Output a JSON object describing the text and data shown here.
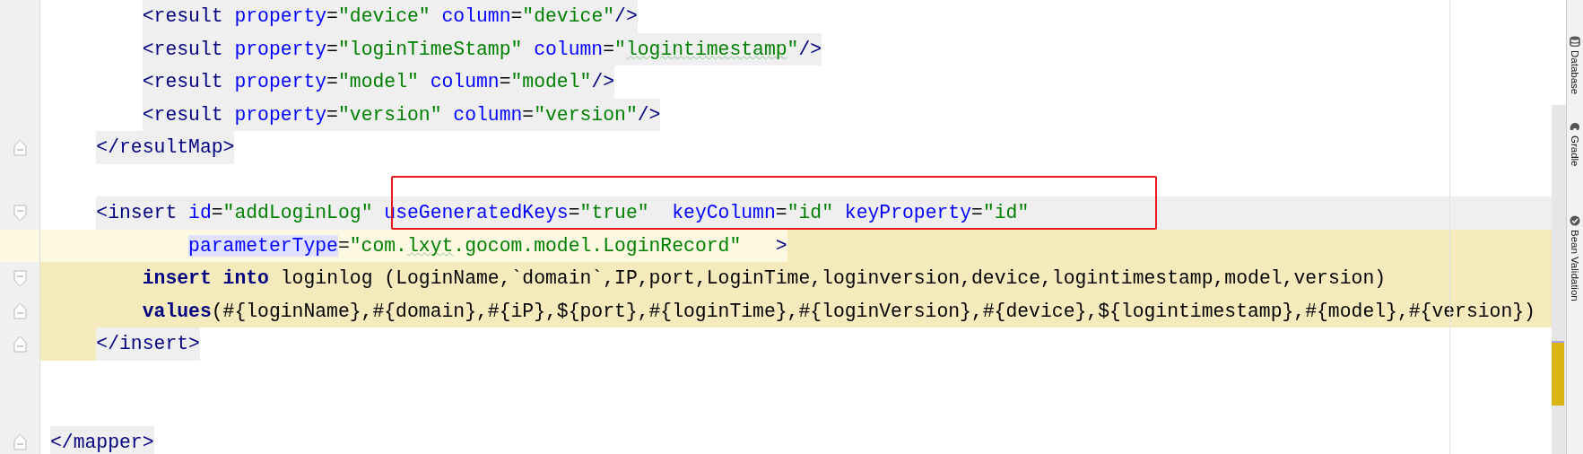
{
  "editor": {
    "lines": [
      {
        "kind": "tag",
        "tokens": [
          {
            "kind": "tag",
            "text": "        <result "
          },
          {
            "kind": "attr",
            "text": "property"
          },
          {
            "kind": "text",
            "text": "="
          },
          {
            "kind": "value",
            "text": "\"device\""
          },
          {
            "kind": "attr",
            "text": " column"
          },
          {
            "kind": "text",
            "text": "="
          },
          {
            "kind": "value",
            "text": "\"device\""
          },
          {
            "kind": "tag",
            "text": "/>"
          }
        ]
      },
      {
        "kind": "tag",
        "tokens": [
          {
            "kind": "tag",
            "text": "        <result "
          },
          {
            "kind": "attr",
            "text": "property"
          },
          {
            "kind": "text",
            "text": "="
          },
          {
            "kind": "value",
            "text": "\"loginTimeStamp\""
          },
          {
            "kind": "attr",
            "text": " column"
          },
          {
            "kind": "text",
            "text": "="
          },
          {
            "kind": "value",
            "text": "\""
          },
          {
            "kind": "value",
            "text": "logintimestamp",
            "typo": true
          },
          {
            "kind": "value",
            "text": "\""
          },
          {
            "kind": "tag",
            "text": "/>"
          }
        ]
      },
      {
        "kind": "tag",
        "tokens": [
          {
            "kind": "tag",
            "text": "        <result "
          },
          {
            "kind": "attr",
            "text": "property"
          },
          {
            "kind": "text",
            "text": "="
          },
          {
            "kind": "value",
            "text": "\"model\""
          },
          {
            "kind": "attr",
            "text": " column"
          },
          {
            "kind": "text",
            "text": "="
          },
          {
            "kind": "value",
            "text": "\"model\""
          },
          {
            "kind": "tag",
            "text": "/>"
          }
        ]
      },
      {
        "kind": "tag",
        "tokens": [
          {
            "kind": "tag",
            "text": "        <result "
          },
          {
            "kind": "attr",
            "text": "property"
          },
          {
            "kind": "text",
            "text": "="
          },
          {
            "kind": "value",
            "text": "\"version\""
          },
          {
            "kind": "attr",
            "text": " column"
          },
          {
            "kind": "text",
            "text": "="
          },
          {
            "kind": "value",
            "text": "\"version\""
          },
          {
            "kind": "tag",
            "text": "/>"
          }
        ]
      },
      {
        "kind": "tag",
        "fold_close": true,
        "tokens": [
          {
            "kind": "tag",
            "text": "    </resultMap>"
          }
        ]
      },
      {
        "kind": "blank"
      },
      {
        "kind": "current",
        "fold_open": true,
        "tokens": [
          {
            "kind": "tag",
            "text": "    <insert "
          },
          {
            "kind": "attr",
            "text": "id"
          },
          {
            "kind": "text",
            "text": "="
          },
          {
            "kind": "value",
            "text": "\"addLoginLog\""
          },
          {
            "kind": "attr",
            "text": " useGeneratedKeys"
          },
          {
            "kind": "text",
            "text": "="
          },
          {
            "kind": "value",
            "text": "\"true\""
          },
          {
            "kind": "attr",
            "text": "  keyColumn"
          },
          {
            "kind": "text",
            "text": "="
          },
          {
            "kind": "value",
            "text": "\"id\""
          },
          {
            "kind": "attr",
            "text": " keyProperty"
          },
          {
            "kind": "text",
            "text": "="
          },
          {
            "kind": "value",
            "text": "\"id\""
          }
        ]
      },
      {
        "kind": "open",
        "tokens": [
          {
            "kind": "attr",
            "text": "            parameterType",
            "marked": true
          },
          {
            "kind": "text",
            "text": "="
          },
          {
            "kind": "value",
            "text": "\"com."
          },
          {
            "kind": "value",
            "text": "lxyt",
            "typo": true
          },
          {
            "kind": "value",
            "text": ".gocom.model.LoginRecord\""
          },
          {
            "kind": "tag",
            "text": "   >"
          }
        ]
      },
      {
        "kind": "injected",
        "fold_open": true,
        "tokens": [
          {
            "kind": "keyword",
            "text": "        insert"
          },
          {
            "kind": "keyword",
            "text": " into"
          },
          {
            "kind": "text",
            "text": " loginlog (LoginName,`domain`,IP,port,LoginTime,loginversion,device,logintimestamp,model,version)"
          }
        ]
      },
      {
        "kind": "injected",
        "fold_close": true,
        "tokens": [
          {
            "kind": "keyword",
            "text": "        values"
          },
          {
            "kind": "text",
            "text": "(#{loginName},#{domain},#{iP},${port},#{loginTime},#{loginVersion},#{device},${logintimestamp},#{model},#{version})"
          }
        ]
      },
      {
        "kind": "close",
        "fold_close": true,
        "tokens": [
          {
            "kind": "tag",
            "text": "    </insert>"
          }
        ]
      },
      {
        "kind": "blank"
      },
      {
        "kind": "blank"
      },
      {
        "kind": "tag",
        "fold_close": true,
        "tokens": [
          {
            "kind": "tag",
            "text": "</mapper>"
          }
        ]
      }
    ]
  },
  "tool_windows": [
    {
      "kind": "database",
      "label": "Database"
    },
    {
      "kind": "gradle",
      "label": "Gradle"
    },
    {
      "kind": "bean",
      "label": "Bean Validation"
    }
  ]
}
